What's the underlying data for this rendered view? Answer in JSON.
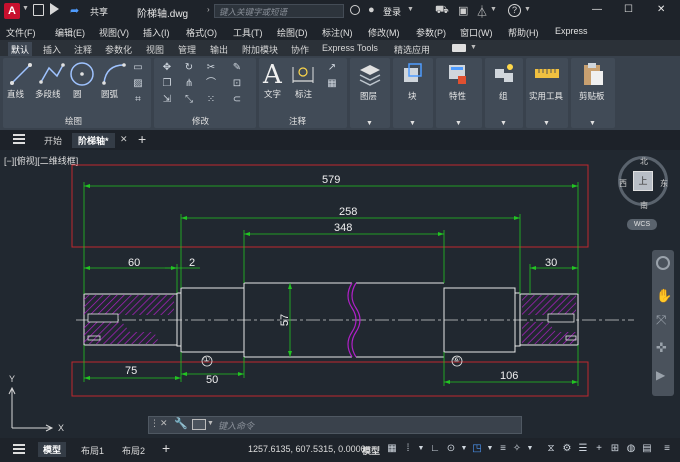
{
  "titlebar": {
    "app_letter": "A",
    "share_label": "共享",
    "file_name": "阶梯轴.dwg",
    "search_placeholder": "键入关键字或短语",
    "login_label": "登录",
    "help_icon": "?",
    "window_controls": [
      "—",
      "☐",
      "✕"
    ]
  },
  "menubar": {
    "items": [
      "文件(F)",
      "编辑(E)",
      "视图(V)",
      "插入(I)",
      "格式(O)",
      "工具(T)",
      "绘图(D)",
      "标注(N)",
      "修改(M)",
      "参数(P)",
      "窗口(W)",
      "帮助(H)",
      "Express"
    ]
  },
  "ribbon_tabs": [
    "默认",
    "插入",
    "注释",
    "参数化",
    "视图",
    "管理",
    "输出",
    "附加模块",
    "协作",
    "Express Tools",
    "精选应用"
  ],
  "ribbon": {
    "draw_group": {
      "label": "绘图",
      "buttons": [
        "直线",
        "多段线",
        "圆",
        "圆弧"
      ]
    },
    "modify_group": {
      "label": "修改"
    },
    "annotation_group": {
      "label": "注释",
      "buttons": [
        "文字",
        "标注"
      ]
    },
    "big_buttons": [
      "图层",
      "块",
      "特性",
      "组",
      "实用工具",
      "剪贴板"
    ]
  },
  "doc_tabs": {
    "start": "开始",
    "current": "阶梯轴*"
  },
  "viewport": {
    "label": "[−][俯视][二维线框]",
    "compass": {
      "n": "北",
      "s": "南",
      "w": "西",
      "e": "东",
      "top": "上",
      "wcs": "WCS"
    }
  },
  "dimensions": {
    "overall": "579",
    "d258": "258",
    "d348": "348",
    "d60": "60",
    "d2": "2",
    "d30": "30",
    "d57": "57",
    "d75": "75",
    "d50": "50",
    "d106": "106"
  },
  "section_markers": [
    "①",
    "⑥"
  ],
  "command": {
    "placeholder": "键入命令"
  },
  "statusbar": {
    "layout_tabs": [
      "模型",
      "布局1",
      "布局2"
    ],
    "coordinates": "1257.6135, 607.5315, 0.0000",
    "model_label": "模型"
  },
  "colors": {
    "accent_red": "#c8102e",
    "dim_green": "#22c422",
    "geometry_white": "#e8e8e8",
    "hatch_magenta": "#b020c8",
    "annotation_red": "#c0282e"
  }
}
